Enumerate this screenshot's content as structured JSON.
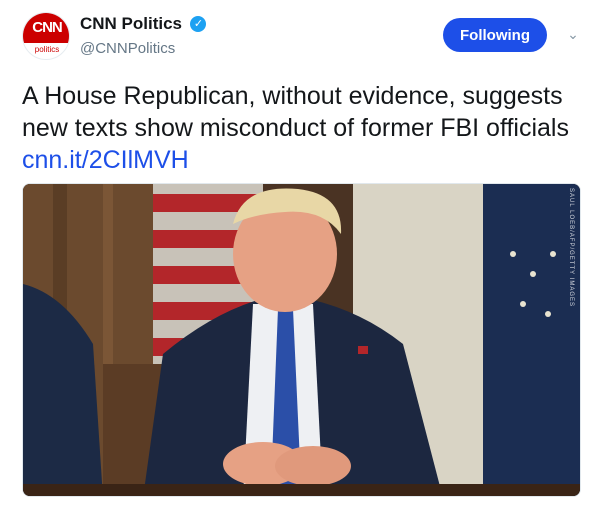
{
  "account": {
    "display_name": "CNN Politics",
    "handle": "@CNNPolitics",
    "verified": true,
    "avatar": {
      "logo_text": "CNN",
      "sub_text": "politics"
    }
  },
  "actions": {
    "follow_label": "Following",
    "caret_icon": "chevron-down-icon"
  },
  "tweet": {
    "text": "A House Republican, without evidence, suggests new texts show misconduct of former FBI officials ",
    "link_text": "cnn.it/2CIlMVH"
  },
  "media": {
    "credit": "SAUL LOEB/AFP/GETTY IMAGES"
  },
  "colors": {
    "accent": "#1d4fe8",
    "brand_red": "#cc0000",
    "verified": "#1da1f2",
    "muted": "#657786"
  }
}
